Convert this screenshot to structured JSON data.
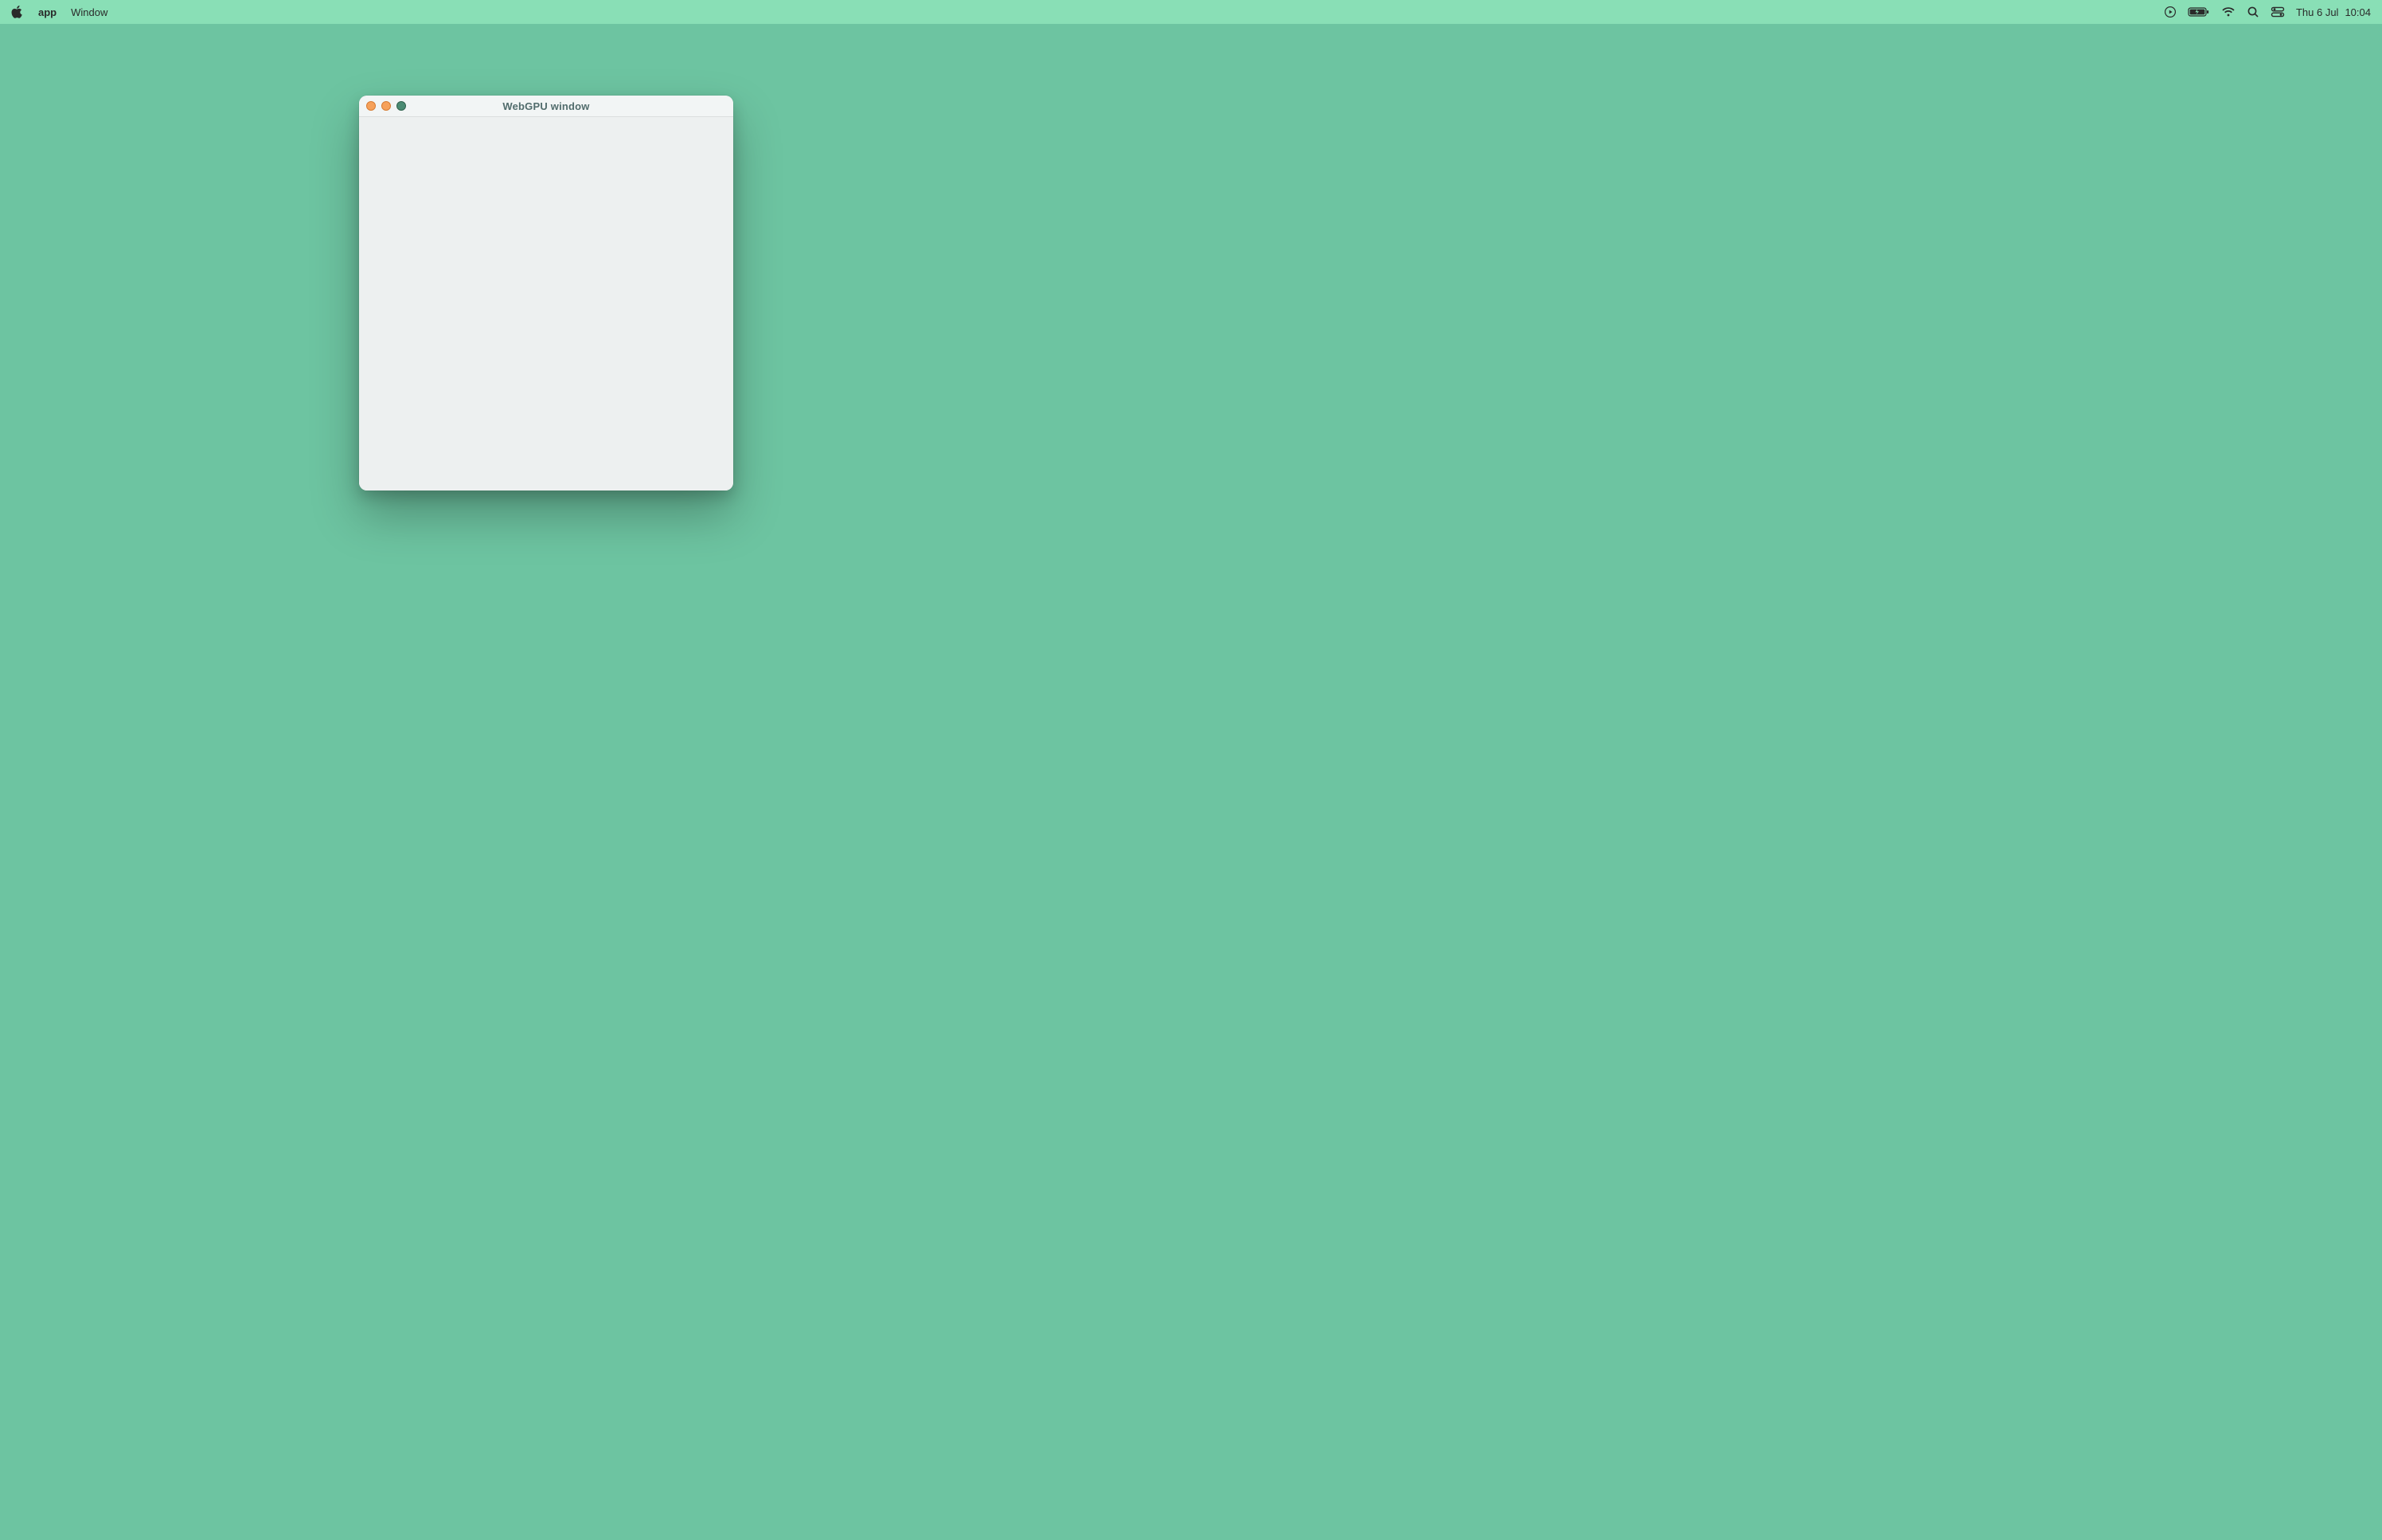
{
  "menubar": {
    "app_name": "app",
    "menu_items": [
      "Window"
    ],
    "date": "Thu 6 Jul",
    "time": "10:04"
  },
  "window": {
    "title": "WebGPU window"
  },
  "icons": {
    "apple": "apple-logo",
    "media": "media-playback",
    "battery": "battery-charging",
    "wifi": "wifi",
    "search": "spotlight-search",
    "control_center": "control-center"
  },
  "colors": {
    "desktop_bg": "#6dc4a1",
    "menubar_bg": "#89dfb6",
    "window_bg": "#edf0f0",
    "titlebar_bg": "#f2f5f5",
    "traffic_close": "#f6a15a",
    "traffic_minimize": "#f6a15a",
    "traffic_zoom": "#4a8b73"
  }
}
